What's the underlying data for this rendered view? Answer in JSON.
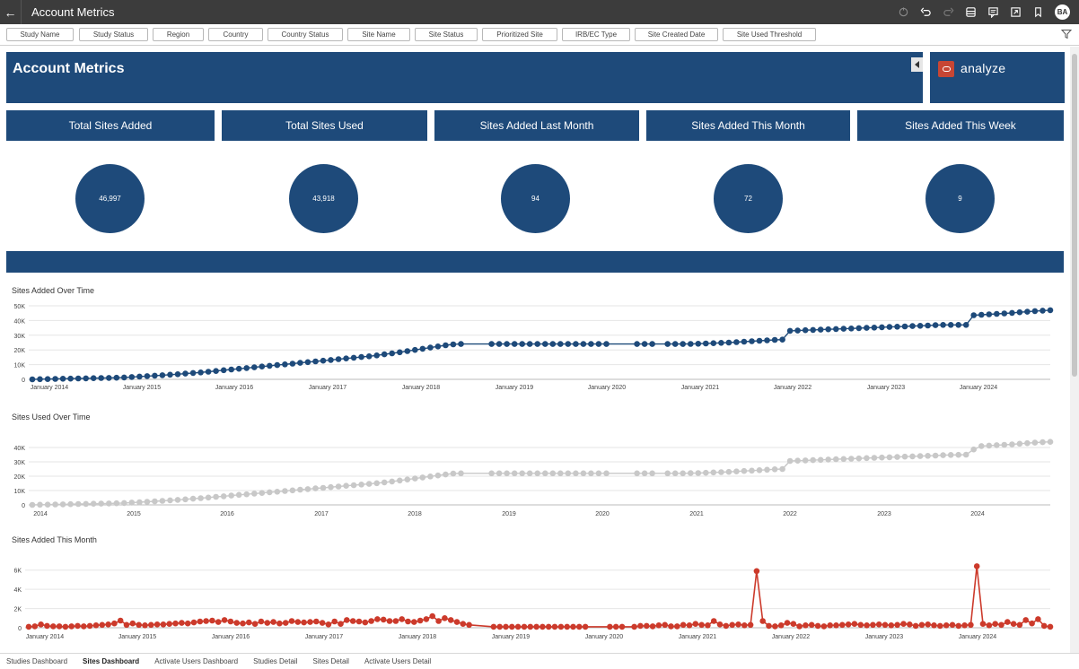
{
  "app": {
    "title": "Account Metrics",
    "avatar": "BA"
  },
  "toolbar_icons": [
    "refresh-icon",
    "undo-icon",
    "redo-icon",
    "data-icon",
    "comment-icon",
    "present-icon",
    "bookmark-icon"
  ],
  "filters": [
    "Study Name",
    "Study Status",
    "Region",
    "Country",
    "Country Status",
    "Site Name",
    "Site Status",
    "Prioritized Site",
    "IRB/EC Type",
    "Site Created Date",
    "Site Used Threshold"
  ],
  "banner": {
    "title": "Account Metrics",
    "logo_text": "analyze"
  },
  "kpis": [
    {
      "label": "Total Sites Added",
      "value": "46,997"
    },
    {
      "label": "Total Sites Used",
      "value": "43,918"
    },
    {
      "label": "Sites Added Last Month",
      "value": "94"
    },
    {
      "label": "Sites Added This Month",
      "value": "72"
    },
    {
      "label": "Sites Added This Week",
      "value": "9"
    }
  ],
  "colors": {
    "navy": "#1e4a7a",
    "gray_series": "#c8c8c8",
    "red_series": "#cc3a2b",
    "grid": "#e6e6e6"
  },
  "chart_data": [
    {
      "type": "line",
      "title": "Sites Added Over Time",
      "x_tick_labels": [
        "January 2014",
        "January 2015",
        "January 2016",
        "January 2017",
        "January 2018",
        "January 2019",
        "January 2020",
        "January 2021",
        "January 2022",
        "January 2023",
        "January 2024"
      ],
      "y_tick_labels": [
        "0",
        "10K",
        "20K",
        "30K",
        "40K",
        "50K"
      ],
      "ylim": [
        0,
        50000
      ],
      "grid": true,
      "series": [
        {
          "color": "#1e4a7a",
          "x_start": "2014-01",
          "interval": "month",
          "values": [
            0,
            100,
            200,
            300,
            400,
            500,
            600,
            700,
            800,
            900,
            1000,
            1100,
            1300,
            1600,
            1900,
            2200,
            2500,
            2800,
            3200,
            3500,
            3900,
            4300,
            4700,
            5200,
            5700,
            6200,
            6700,
            7200,
            7700,
            8200,
            8700,
            9200,
            9700,
            10200,
            10700,
            11200,
            11700,
            12200,
            12700,
            13200,
            13700,
            14200,
            14700,
            15200,
            15700,
            16300,
            17000,
            17700,
            18400,
            19200,
            20000,
            20800,
            21600,
            22400,
            23200,
            23800,
            24000,
            null,
            null,
            null,
            24000,
            24000,
            24000,
            24000,
            24000,
            24000,
            24000,
            24000,
            24000,
            24000,
            24000,
            24000,
            24000,
            24000,
            24000,
            24000,
            null,
            null,
            null,
            24000,
            24000,
            24000,
            null,
            24000,
            24000,
            24000,
            24100,
            24200,
            24400,
            24600,
            24800,
            25000,
            25300,
            25600,
            25900,
            26200,
            26500,
            26800,
            27000,
            33000,
            33200,
            33400,
            33600,
            33800,
            34000,
            34200,
            34400,
            34600,
            34800,
            35000,
            35200,
            35400,
            35600,
            35800,
            36000,
            36200,
            36400,
            36600,
            36800,
            37000,
            37000,
            37000,
            37000,
            43600,
            43900,
            44200,
            44500,
            44800,
            45200,
            45600,
            46000,
            46400,
            46700,
            46997
          ]
        }
      ]
    },
    {
      "type": "line",
      "title": "Sites Used Over Time",
      "x_tick_labels": [
        "2014",
        "2015",
        "2016",
        "2017",
        "2018",
        "2019",
        "2020",
        "2021",
        "2022",
        "2023",
        "2024"
      ],
      "y_tick_labels": [
        "0",
        "10K",
        "20K",
        "30K",
        "40K"
      ],
      "ylim": [
        0,
        45000
      ],
      "grid": true,
      "series": [
        {
          "color": "#c8c8c8",
          "x_start": "2014-01",
          "interval": "month",
          "values": [
            0,
            100,
            200,
            300,
            400,
            500,
            600,
            700,
            800,
            900,
            1000,
            1100,
            1300,
            1600,
            1900,
            2200,
            2500,
            2800,
            3200,
            3500,
            3900,
            4300,
            4700,
            5100,
            5600,
            6000,
            6500,
            7000,
            7400,
            7900,
            8300,
            8800,
            9200,
            9700,
            10100,
            10600,
            11000,
            11500,
            11900,
            12400,
            12800,
            13300,
            13700,
            14200,
            14600,
            15100,
            15700,
            16300,
            17000,
            17700,
            18400,
            19100,
            19800,
            20500,
            21200,
            21800,
            22000,
            null,
            null,
            null,
            22000,
            22000,
            22000,
            22000,
            22000,
            22000,
            22000,
            22000,
            22000,
            22000,
            22000,
            22000,
            22000,
            22000,
            22000,
            22000,
            null,
            null,
            null,
            22000,
            22000,
            22000,
            null,
            22000,
            22000,
            22000,
            22100,
            22200,
            22400,
            22600,
            22800,
            23000,
            23300,
            23600,
            23900,
            24200,
            24500,
            24800,
            25000,
            30600,
            30800,
            31000,
            31200,
            31400,
            31600,
            31800,
            32000,
            32200,
            32400,
            32600,
            32800,
            33000,
            33200,
            33400,
            33600,
            33800,
            34000,
            34200,
            34400,
            34600,
            34800,
            34900,
            35000,
            38600,
            41000,
            41300,
            41600,
            41900,
            42200,
            42600,
            43000,
            43400,
            43700,
            43918
          ]
        }
      ]
    },
    {
      "type": "line",
      "title": "Sites Added This Month",
      "x_tick_labels": [
        "January 2014",
        "January 2015",
        "January 2016",
        "January 2017",
        "January 2018",
        "January 2019",
        "January 2020",
        "January 2021",
        "January 2022",
        "January 2023",
        "January 2024"
      ],
      "y_tick_labels": [
        "0",
        "2K",
        "4K",
        "6K"
      ],
      "ylim": [
        0,
        7000
      ],
      "grid": true,
      "series": [
        {
          "color": "#cc3a2b",
          "x_start": "2014-01",
          "interval": "month",
          "values": [
            100,
            150,
            350,
            200,
            150,
            150,
            100,
            150,
            200,
            150,
            200,
            250,
            300,
            350,
            450,
            750,
            300,
            450,
            300,
            250,
            300,
            350,
            350,
            400,
            450,
            500,
            450,
            550,
            650,
            700,
            750,
            600,
            800,
            650,
            500,
            450,
            550,
            400,
            650,
            500,
            600,
            450,
            500,
            700,
            600,
            550,
            600,
            650,
            500,
            350,
            650,
            400,
            800,
            700,
            650,
            550,
            700,
            900,
            850,
            700,
            700,
            900,
            650,
            600,
            750,
            900,
            1200,
            700,
            1000,
            800,
            600,
            400,
            300,
            null,
            null,
            null,
            100,
            100,
            100,
            100,
            100,
            100,
            100,
            100,
            100,
            100,
            100,
            100,
            100,
            100,
            100,
            100,
            null,
            null,
            null,
            100,
            100,
            100,
            null,
            100,
            200,
            200,
            150,
            250,
            300,
            150,
            150,
            300,
            250,
            400,
            300,
            250,
            700,
            350,
            200,
            300,
            350,
            250,
            300,
            5900,
            700,
            200,
            150,
            250,
            500,
            400,
            150,
            250,
            300,
            200,
            150,
            250,
            250,
            300,
            350,
            400,
            300,
            250,
            300,
            350,
            300,
            250,
            300,
            400,
            350,
            200,
            300,
            350,
            250,
            200,
            250,
            300,
            200,
            250,
            300,
            6400,
            400,
            250,
            400,
            300,
            600,
            400,
            300,
            800,
            450,
            900,
            200,
            100
          ]
        }
      ]
    }
  ],
  "bottom_tabs": [
    {
      "label": "Studies Dashboard",
      "active": false
    },
    {
      "label": "Sites Dashboard",
      "active": true
    },
    {
      "label": "Activate Users Dashboard",
      "active": false
    },
    {
      "label": "Studies Detail",
      "active": false
    },
    {
      "label": "Sites Detail",
      "active": false
    },
    {
      "label": "Activate Users Detail",
      "active": false
    }
  ]
}
